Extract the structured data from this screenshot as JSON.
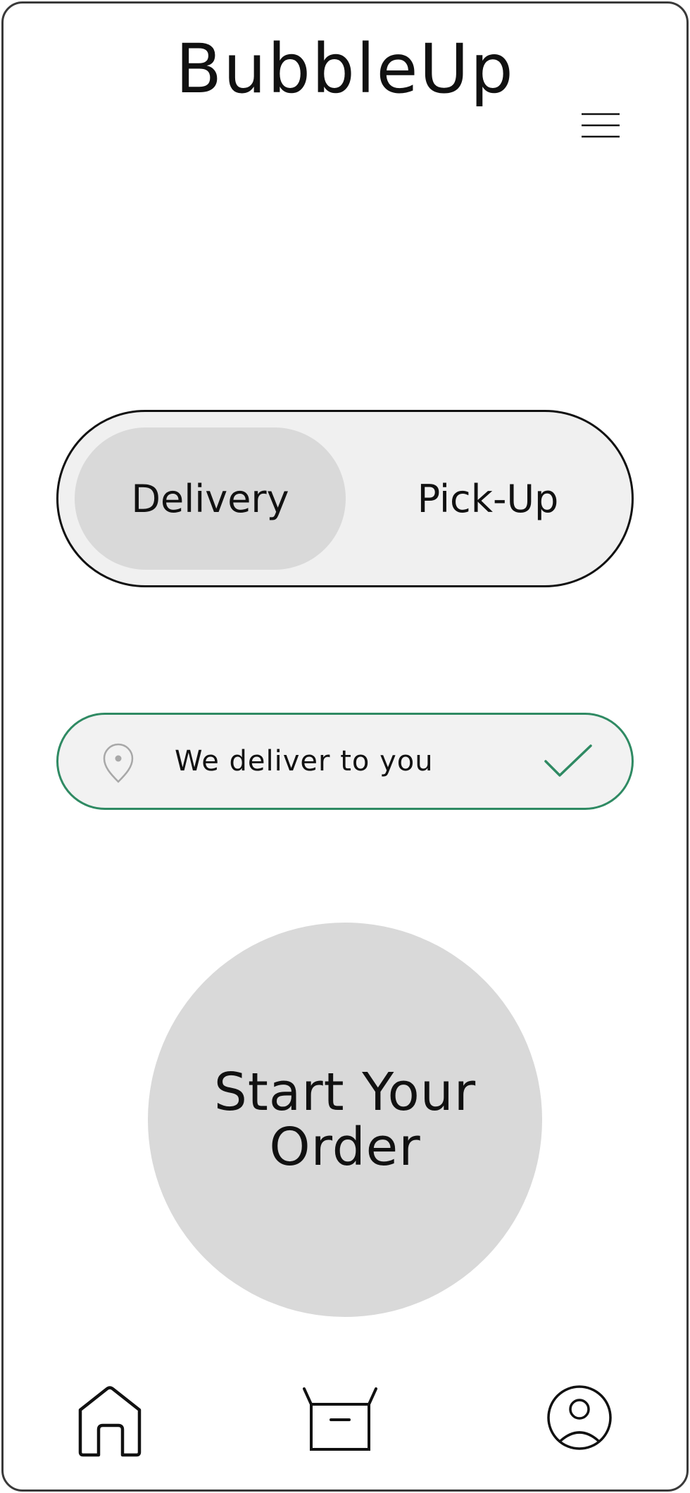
{
  "app": {
    "title": "BubbleUp"
  },
  "header": {
    "menu_icon": "hamburger-menu-icon"
  },
  "mode_toggle": {
    "options": [
      {
        "label": "Delivery",
        "selected": true
      },
      {
        "label": "Pick-Up",
        "selected": false
      }
    ]
  },
  "delivery_info": {
    "text": "We deliver to you",
    "leading_icon": "location-pin-icon",
    "trailing_icon": "checkmark-icon",
    "status_color": "#2f8a63"
  },
  "start_order": {
    "label": "Start Your Order"
  },
  "bottom_nav": {
    "items": [
      {
        "icon": "home-icon"
      },
      {
        "icon": "box-icon"
      },
      {
        "icon": "account-icon"
      }
    ]
  },
  "colors": {
    "selected_option": "#d9d9d9",
    "toggle_background": "#f0f0f0",
    "success_border": "#2f8a63",
    "start_order_circle": "#d9d9d9"
  }
}
